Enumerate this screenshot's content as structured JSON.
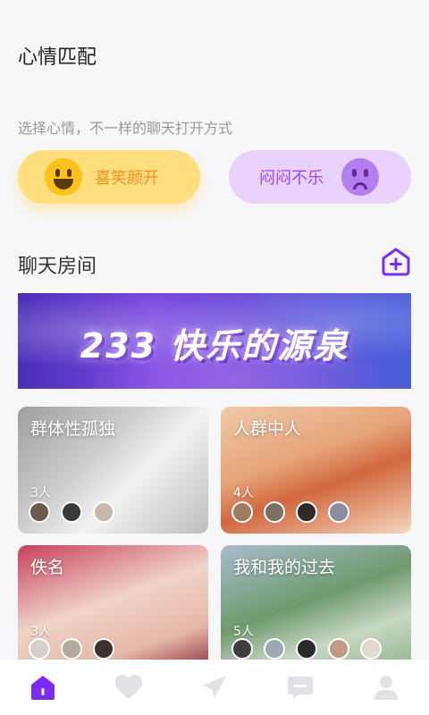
{
  "header": {
    "title": "心情匹配",
    "subtitle": "选择心情，不一样的聊天打开方式"
  },
  "moods": [
    {
      "label": "喜笑颜开",
      "icon": "happy-face-icon",
      "color": "#ff8e1e"
    },
    {
      "label": "闷闷不乐",
      "icon": "sad-face-icon",
      "color": "#9b45ff"
    }
  ],
  "rooms_section": {
    "title": "聊天房间",
    "add_icon": "add-room-icon"
  },
  "banner": {
    "text": "233 快乐的源泉"
  },
  "rooms": [
    {
      "name": "群体性孤独",
      "count": "3人",
      "avatars": [
        "#6b5a4e",
        "#3a3a3a",
        "#c9b7a9"
      ]
    },
    {
      "name": "人群中人",
      "count": "4人",
      "avatars": [
        "#a07b61",
        "#7d6f66",
        "#2f2a28",
        "#8c8c9a"
      ]
    },
    {
      "name": "佚名",
      "count": "3人",
      "avatars": [
        "#d8cfc8",
        "#b9a99c",
        "#3c3230"
      ]
    },
    {
      "name": "我和我的过去",
      "count": "5人",
      "avatars": [
        "#3f3f3f",
        "#9aa9b4",
        "#2a2a2a",
        "#c29a84",
        "#e1d8cf"
      ]
    }
  ],
  "tabbar": [
    {
      "name": "home",
      "icon": "home-icon",
      "active": true
    },
    {
      "name": "favorites",
      "icon": "heart-icon",
      "active": false
    },
    {
      "name": "discover",
      "icon": "send-icon",
      "active": false
    },
    {
      "name": "messages",
      "icon": "message-icon",
      "active": false
    },
    {
      "name": "profile",
      "icon": "user-icon",
      "active": false
    }
  ],
  "colors": {
    "accent": "#7a2cf5",
    "inactive_icon": "#e2e2e6"
  }
}
